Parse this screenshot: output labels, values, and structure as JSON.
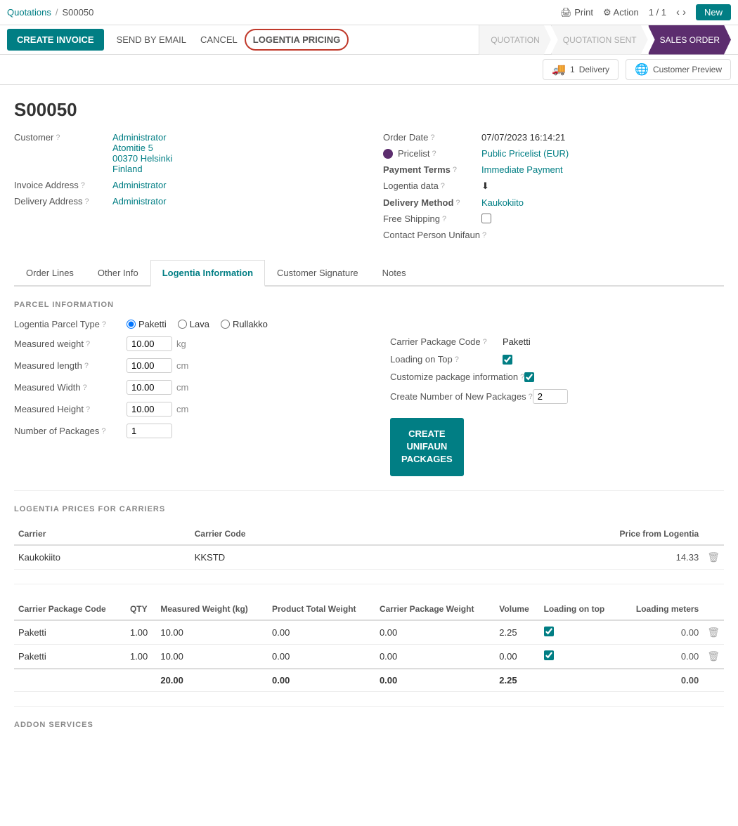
{
  "breadcrumb": {
    "parent": "Quotations",
    "separator": "/",
    "current": "S00050",
    "actions": {
      "print": "Print",
      "action": "Action",
      "page": "1 / 1",
      "new_label": "New"
    }
  },
  "toolbar": {
    "create_invoice_label": "CREATE INVOICE",
    "send_email_label": "SEND BY EMAIL",
    "cancel_label": "CANCEL",
    "logentia_label": "LOGENTIA PRICING"
  },
  "status_steps": [
    {
      "label": "QUOTATION",
      "active": false
    },
    {
      "label": "QUOTATION SENT",
      "active": false
    },
    {
      "label": "SALES ORDER",
      "active": true
    }
  ],
  "info_chips": [
    {
      "icon": "🚚",
      "count": "1",
      "label": "Delivery"
    },
    {
      "icon": "🌐",
      "label": "Customer Preview"
    }
  ],
  "order": {
    "id": "S00050",
    "customer_label": "Customer",
    "customer_name": "Administrator",
    "customer_address1": "Atomitie 5",
    "customer_address2": "00370 Helsinki",
    "customer_country": "Finland",
    "order_date_label": "Order Date",
    "order_date": "07/07/2023 16:14:21",
    "pricelist_label": "Pricelist",
    "pricelist_value": "Public Pricelist (EUR)",
    "payment_terms_label": "Payment Terms",
    "payment_terms_value": "Immediate Payment",
    "logentia_data_label": "Logentia data",
    "logentia_data_icon": "⬇",
    "delivery_method_label": "Delivery Method",
    "delivery_method_value": "Kaukokiito",
    "free_shipping_label": "Free Shipping",
    "contact_person_label": "Contact Person Unifaun",
    "invoice_address_label": "Invoice Address",
    "invoice_address_value": "Administrator",
    "delivery_address_label": "Delivery Address",
    "delivery_address_value": "Administrator"
  },
  "tabs": [
    {
      "label": "Order Lines",
      "active": false
    },
    {
      "label": "Other Info",
      "active": false
    },
    {
      "label": "Logentia Information",
      "active": true
    },
    {
      "label": "Customer Signature",
      "active": false
    },
    {
      "label": "Notes",
      "active": false
    }
  ],
  "parcel_section": {
    "title": "PARCEL INFORMATION",
    "parcel_type_label": "Logentia Parcel Type",
    "parcel_types": [
      "Paketti",
      "Lava",
      "Rullakko"
    ],
    "selected_type": "Paketti",
    "fields_left": [
      {
        "label": "Measured weight",
        "value": "10.00",
        "unit": "kg"
      },
      {
        "label": "Measured length",
        "value": "10.00",
        "unit": "cm"
      },
      {
        "label": "Measured Width",
        "value": "10.00",
        "unit": "cm"
      },
      {
        "label": "Measured Height",
        "value": "10.00",
        "unit": "cm"
      },
      {
        "label": "Number of Packages",
        "value": "1",
        "unit": ""
      }
    ],
    "fields_right": [
      {
        "label": "Carrier Package Code",
        "value": "Paketti"
      },
      {
        "label": "Loading on Top",
        "value": true,
        "type": "checkbox"
      },
      {
        "label": "Customize package information",
        "value": true,
        "type": "checkbox"
      },
      {
        "label": "Create Number of New Packages",
        "value": "2"
      }
    ],
    "create_button_label": "CREATE\nUNIFAUN\nPACKAGES"
  },
  "carriers_section": {
    "title": "LOGENTIA PRICES FOR CARRIERS",
    "columns": [
      "Carrier",
      "Carrier Code",
      "Price from Logentia"
    ],
    "rows": [
      {
        "carrier": "Kaukokiito",
        "code": "KKSTD",
        "price": "14.33"
      }
    ]
  },
  "packages_table": {
    "columns": [
      "Carrier Package Code",
      "QTY",
      "Measured Weight (kg)",
      "Product Total Weight",
      "Carrier Package Weight",
      "Volume",
      "Loading on top",
      "Loading meters"
    ],
    "rows": [
      {
        "code": "Paketti",
        "qty": "1.00",
        "measured_weight": "10.00",
        "product_total": "0.00",
        "carrier_weight": "0.00",
        "volume": "2.25",
        "loading_top": true,
        "loading_meters": "0.00"
      },
      {
        "code": "Paketti",
        "qty": "1.00",
        "measured_weight": "10.00",
        "product_total": "0.00",
        "carrier_weight": "0.00",
        "volume": "0.00",
        "loading_top": true,
        "loading_meters": "0.00"
      }
    ],
    "totals": {
      "measured_weight": "20.00",
      "product_total": "0.00",
      "carrier_weight": "0.00",
      "volume": "2.25",
      "loading_meters": "0.00"
    }
  },
  "addon_section": {
    "title": "ADDON SERVICES"
  }
}
